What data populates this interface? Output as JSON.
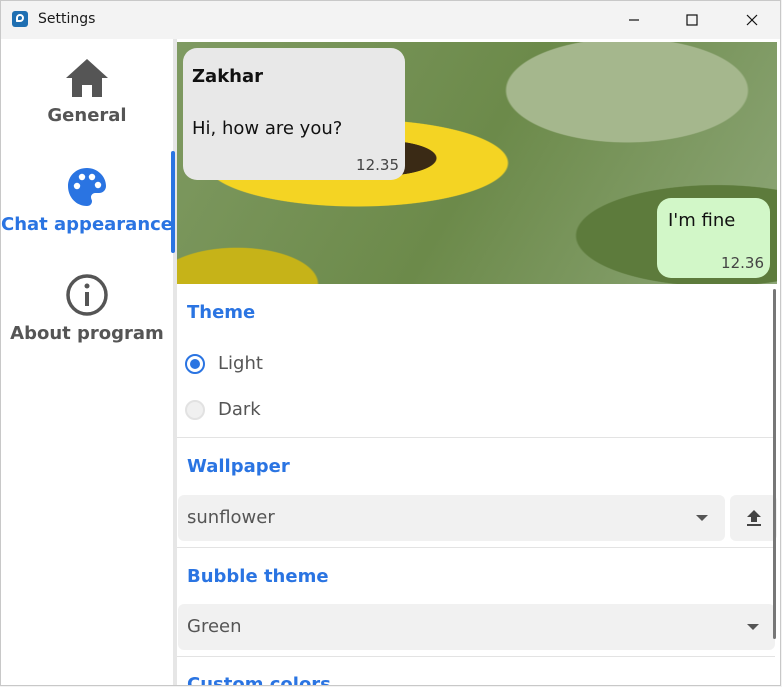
{
  "window": {
    "title": "Settings"
  },
  "sidebar": {
    "items": [
      {
        "label": "General",
        "icon": "home-icon"
      },
      {
        "label": "Chat appearance",
        "icon": "palette-icon"
      },
      {
        "label": "About program",
        "icon": "info-icon"
      }
    ],
    "active_index": 1
  },
  "preview": {
    "incoming": {
      "name": "Zakhar",
      "text": "Hi, how are you?",
      "time": "12.35"
    },
    "outgoing": {
      "text": "I'm fine",
      "time": "12.36"
    }
  },
  "settings": {
    "theme": {
      "title": "Theme",
      "options": [
        {
          "label": "Light",
          "checked": true
        },
        {
          "label": "Dark",
          "checked": false
        }
      ]
    },
    "wallpaper": {
      "title": "Wallpaper",
      "value": "sunflower"
    },
    "bubble_theme": {
      "title": "Bubble theme",
      "value": "Green"
    },
    "custom_colors": {
      "title": "Custom colors"
    }
  },
  "colors": {
    "accent": "#2a74e2",
    "outgoing_bubble": "#d2f7c8",
    "incoming_bubble": "#e8e8e8"
  }
}
